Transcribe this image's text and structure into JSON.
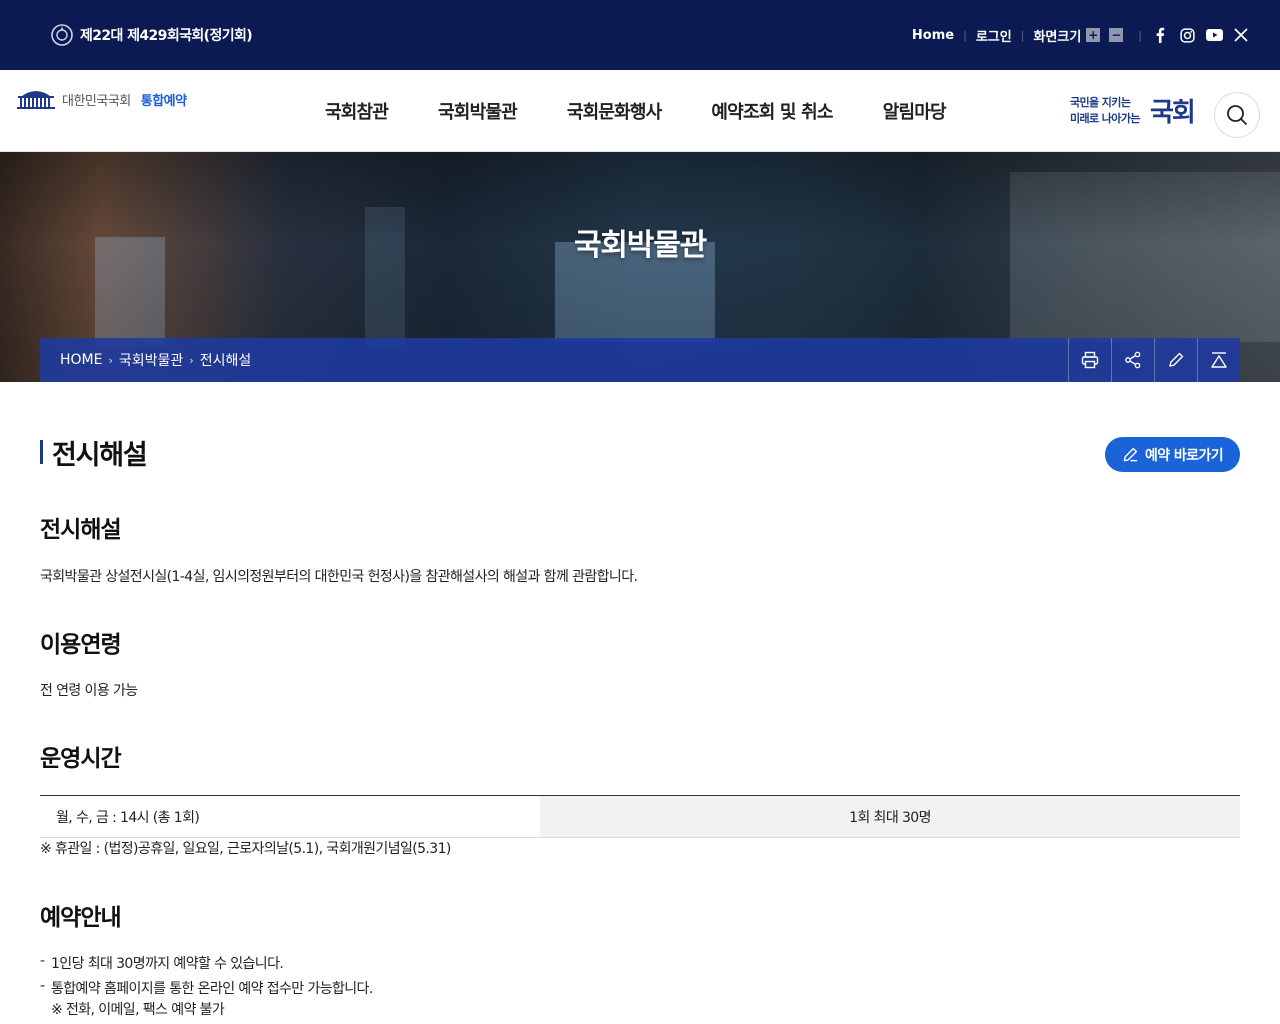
{
  "topbar": {
    "session": "제22대 제429회국회(정기회)",
    "home": "Home",
    "login": "로그인",
    "font_size": "화면크기",
    "zoom_in": "+",
    "zoom_out": "−"
  },
  "header": {
    "logo_text": "대한민국국회",
    "logo_sub": "통합예약",
    "nav": [
      "국회참관",
      "국회박물관",
      "국회문화행사",
      "예약조회 및 취소",
      "알림마당"
    ],
    "slogan_line1": "국민을 지키는",
    "slogan_line2": "미래로 나아가는",
    "slogan_big": "국회"
  },
  "hero": {
    "title": "국회박물관",
    "breadcrumb": [
      "HOME",
      "국회박물관",
      "전시해설"
    ],
    "tools": [
      "print-icon",
      "share-icon",
      "pencil-icon",
      "top-icon"
    ]
  },
  "page": {
    "title": "전시해설",
    "reserve_button": "예약 바로가기",
    "sections": {
      "description": {
        "title": "전시해설",
        "text": "국회박물관 상설전시실(1-4실, 임시의정원부터의 대한민국 헌정사)을 참관해설사의 해설과 함께 관람합니다."
      },
      "age": {
        "title": "이용연령",
        "text": "전 연령 이용 가능"
      },
      "hours": {
        "title": "운영시간",
        "schedule": "월, 수, 금 : 14시 (총 1회)",
        "capacity": "1회 최대 30명",
        "holiday_note": "※ 휴관일 : (법정)공휴일, 일요일, 근로자의날(5.1), 국회개원기념일(5.31)"
      },
      "reservation": {
        "title": "예약안내",
        "items": [
          "1인당 최대 30명까지 예약할 수 있습니다.",
          "통합예약 홈페이지를 통한 온라인 예약 접수만 가능합니다."
        ],
        "sub_note": "※ 전화, 이메일, 팩스 예약 불가"
      }
    }
  },
  "colors": {
    "topbar_bg": "#0b1a52",
    "accent_blue": "#1a63d8",
    "breadcrumb_bg": "#1e3aa0"
  }
}
